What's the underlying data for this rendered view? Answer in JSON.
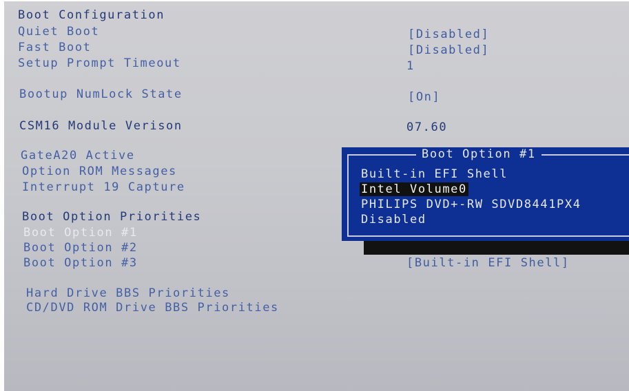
{
  "header": {
    "title": "Boot Configuration"
  },
  "settings": [
    {
      "label": "Quiet Boot",
      "value": "[Disabled]"
    },
    {
      "label": "Fast Boot",
      "value": "[Disabled]"
    },
    {
      "label": "Setup Prompt Timeout",
      "value": "1"
    },
    {
      "label": "Bootup NumLock State",
      "value": "[On]"
    },
    {
      "label": "CSM16 Module Verison",
      "value": "07.60"
    },
    {
      "label": "GateA20 Active",
      "value": ""
    },
    {
      "label": "Option ROM Messages",
      "value": ""
    },
    {
      "label": "Interrupt 19 Capture",
      "value": ""
    }
  ],
  "priorities": {
    "heading": "Boot Option Priorities",
    "options": [
      {
        "label": "Boot Option #1",
        "value": ""
      },
      {
        "label": "Boot Option #2",
        "value": ""
      },
      {
        "label": "Boot Option #3",
        "value": "[Built-in EFI Shell]"
      }
    ]
  },
  "links": {
    "hdd": "Hard Drive BBS Priorities",
    "cdrom": "CD/DVD ROM Drive BBS Priorities"
  },
  "popup": {
    "title": "Boot Option #1",
    "items": [
      "Built-in EFI Shell",
      "Intel Volume0",
      "PHILIPS DVD+-RW SDVD8441PX4",
      "Disabled"
    ],
    "selected_index": 1
  },
  "colors": {
    "screen_bg": "#c8c9ce",
    "text_blue": "#4460a4",
    "popup_bg": "#0e3094",
    "selected_text": "#e8e9f0"
  }
}
